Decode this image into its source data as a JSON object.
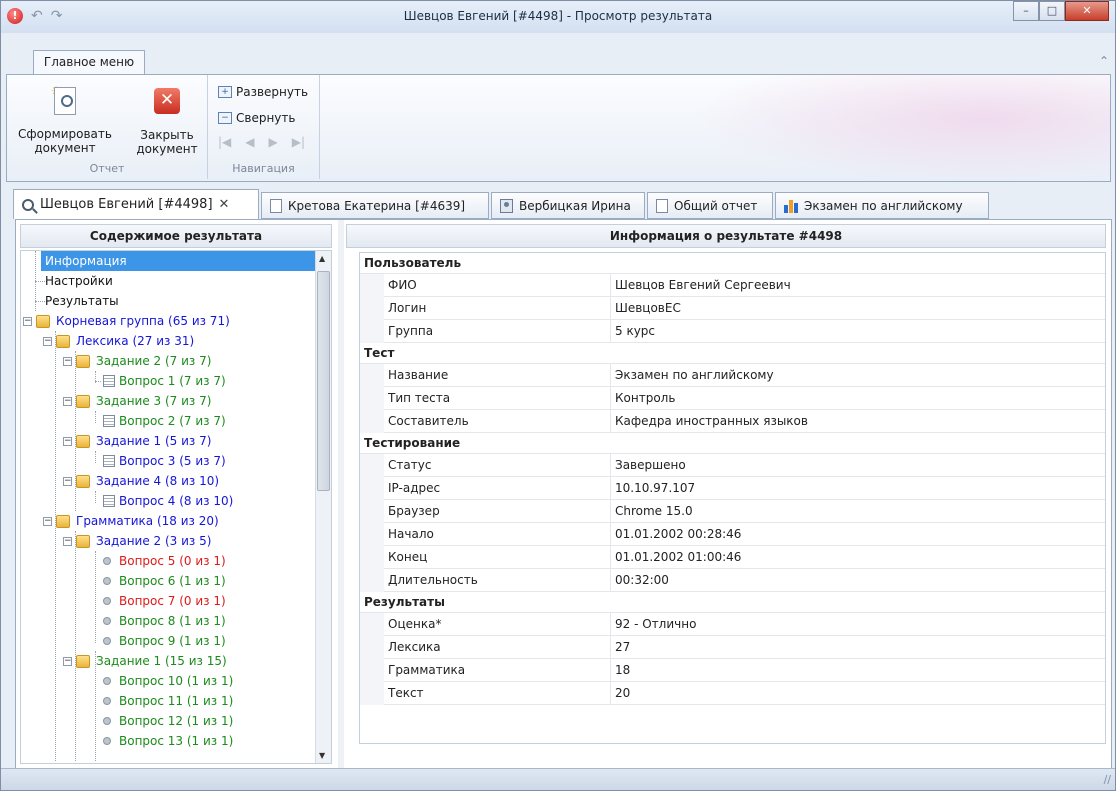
{
  "window": {
    "title": "Шевцов Евгений [#4498] - Просмотр результата",
    "controls": [
      "minimize",
      "maximize",
      "close"
    ]
  },
  "ribbon": {
    "tab_label": "Главное меню",
    "groups": {
      "report": {
        "label": "Отчет",
        "form_doc_label_1": "Сформировать",
        "form_doc_label_2": "документ",
        "close_doc_label_1": "Закрыть",
        "close_doc_label_2": "документ"
      },
      "navigation": {
        "label": "Навигация",
        "expand_label": "Развернуть",
        "collapse_label": "Свернуть",
        "nav_buttons": [
          "first",
          "previous",
          "next",
          "last"
        ]
      }
    }
  },
  "doc_tabs": [
    {
      "label": "Шевцов Евгений [#4498]",
      "icon": "search-icon",
      "active": true
    },
    {
      "label": "Кретова Екатерина [#4639]",
      "icon": "document-icon",
      "active": false
    },
    {
      "label": "Вербицкая Ирина",
      "icon": "user-card-icon",
      "active": false
    },
    {
      "label": "Общий отчет",
      "icon": "report-icon",
      "active": false
    },
    {
      "label": "Экзамен по английскому",
      "icon": "chart-icon",
      "active": false
    }
  ],
  "tree": {
    "header": "Содержимое результата",
    "items": [
      {
        "label": "Информация",
        "color": "selected"
      },
      {
        "label": "Настройки",
        "color": "#111111"
      },
      {
        "label": "Результаты",
        "color": "#111111"
      },
      {
        "label": "Корневая группа (65 из 71)",
        "color": "#1515d8"
      },
      {
        "label": "Лексика (27 из 31)",
        "color": "#1515d8"
      },
      {
        "label": "Задание 2 (7 из 7)",
        "color": "#1c8a1c"
      },
      {
        "label": "Вопрос 1 (7 из 7)",
        "color": "#1c8a1c"
      },
      {
        "label": "Задание 3 (7 из 7)",
        "color": "#1c8a1c"
      },
      {
        "label": "Вопрос 2 (7 из 7)",
        "color": "#1c8a1c"
      },
      {
        "label": "Задание 1 (5 из 7)",
        "color": "#1515d8"
      },
      {
        "label": "Вопрос 3 (5 из 7)",
        "color": "#1515d8"
      },
      {
        "label": "Задание 4 (8 из 10)",
        "color": "#1515d8"
      },
      {
        "label": "Вопрос 4 (8 из 10)",
        "color": "#1515d8"
      },
      {
        "label": "Грамматика (18 из 20)",
        "color": "#1515d8"
      },
      {
        "label": "Задание 2 (3 из 5)",
        "color": "#1515d8"
      },
      {
        "label": "Вопрос 5 (0 из 1)",
        "color": "#e01818"
      },
      {
        "label": "Вопрос 6 (1 из 1)",
        "color": "#1c8a1c"
      },
      {
        "label": "Вопрос 7 (0 из 1)",
        "color": "#e01818"
      },
      {
        "label": "Вопрос 8 (1 из 1)",
        "color": "#1c8a1c"
      },
      {
        "label": "Вопрос 9 (1 из 1)",
        "color": "#1c8a1c"
      },
      {
        "label": "Задание 1 (15 из 15)",
        "color": "#1c8a1c"
      },
      {
        "label": "Вопрос 10 (1 из 1)",
        "color": "#1c8a1c"
      },
      {
        "label": "Вопрос 11 (1 из 1)",
        "color": "#1c8a1c"
      },
      {
        "label": "Вопрос 12 (1 из 1)",
        "color": "#1c8a1c"
      },
      {
        "label": "Вопрос 13 (1 из 1)",
        "color": "#1c8a1c"
      }
    ]
  },
  "info": {
    "header": "Информация о результате #4498",
    "sections": [
      {
        "title": "Пользователь",
        "rows": [
          {
            "key": "ФИО",
            "value": "Шевцов Евгений Сергеевич"
          },
          {
            "key": "Логин",
            "value": "ШевцовЕС"
          },
          {
            "key": "Группа",
            "value": "5 курс"
          }
        ]
      },
      {
        "title": "Тест",
        "rows": [
          {
            "key": "Название",
            "value": "Экзамен по английскому"
          },
          {
            "key": "Тип теста",
            "value": "Контроль"
          },
          {
            "key": "Составитель",
            "value": "Кафедра иностранных языков"
          }
        ]
      },
      {
        "title": "Тестирование",
        "rows": [
          {
            "key": "Статус",
            "value": "Завершено"
          },
          {
            "key": "IP-адрес",
            "value": "10.10.97.107"
          },
          {
            "key": "Браузер",
            "value": "Chrome 15.0"
          },
          {
            "key": "Начало",
            "value": "01.01.2002 00:28:46"
          },
          {
            "key": "Конец",
            "value": "01.01.2002 01:00:46"
          },
          {
            "key": "Длительность",
            "value": "00:32:00"
          }
        ]
      },
      {
        "title": "Результаты",
        "rows": [
          {
            "key": "Оценка*",
            "value": "92 - Отлично"
          },
          {
            "key": "Лексика",
            "value": "27"
          },
          {
            "key": "Грамматика",
            "value": "18"
          },
          {
            "key": "Текст",
            "value": "20"
          }
        ]
      }
    ]
  }
}
